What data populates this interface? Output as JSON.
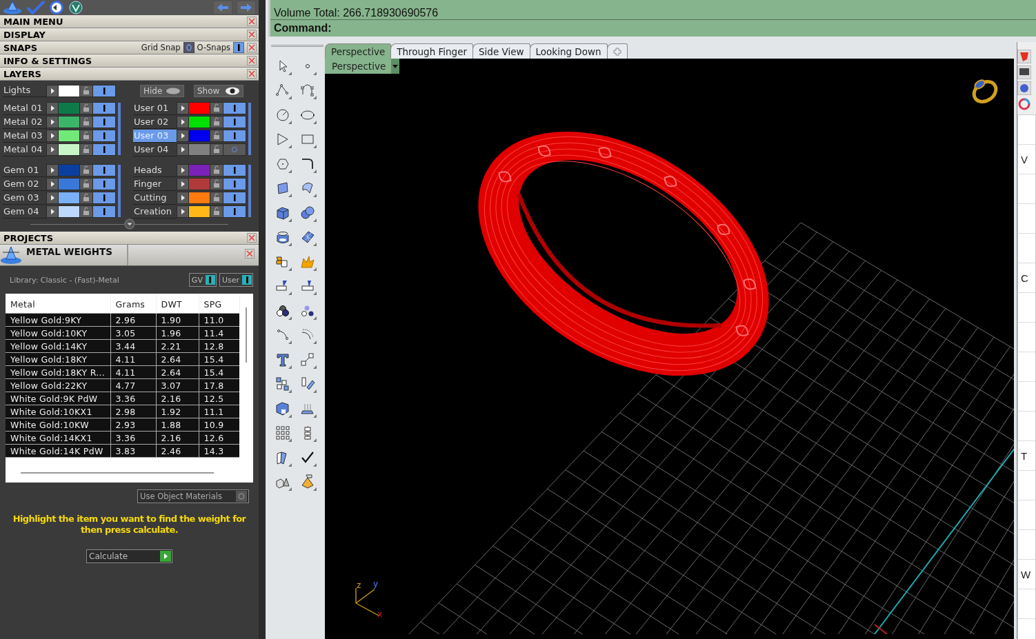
{
  "left_panel": {
    "panel_headers": [
      {
        "label": "MAIN MENU"
      },
      {
        "label": "DISPLAY"
      },
      {
        "label": "SNAPS",
        "toggles": [
          {
            "label": "Grid Snap",
            "on": false
          },
          {
            "label": "O-Snaps",
            "on": true
          }
        ]
      },
      {
        "label": "INFO & SETTINGS"
      },
      {
        "label": "LAYERS"
      }
    ],
    "layers": {
      "lights": {
        "label": "Lights",
        "color": "#ffffff",
        "visible": true
      },
      "hide_button": "Hide",
      "show_button": "Show",
      "groups": [
        {
          "left": [
            {
              "label": "Metal 01",
              "color": "#0e7a4a",
              "visible": true,
              "selected": false
            },
            {
              "label": "Metal 02",
              "color": "#3cb56a",
              "visible": true,
              "selected": false
            },
            {
              "label": "Metal 03",
              "color": "#72e87a",
              "visible": true,
              "selected": false
            },
            {
              "label": "Metal 04",
              "color": "#c8f5c8",
              "visible": true,
              "selected": false
            }
          ],
          "right": [
            {
              "label": "User 01",
              "color": "#ff0000",
              "visible": true,
              "selected": false
            },
            {
              "label": "User 02",
              "color": "#00e000",
              "visible": true,
              "selected": false
            },
            {
              "label": "User 03",
              "color": "#0000ee",
              "visible": true,
              "selected": true
            },
            {
              "label": "User 04",
              "color": "#808080",
              "visible": false,
              "selected": false
            }
          ]
        },
        {
          "left": [
            {
              "label": "Gem 01",
              "color": "#0a3fa0",
              "visible": true,
              "selected": false
            },
            {
              "label": "Gem 02",
              "color": "#3a78d8",
              "visible": true,
              "selected": false
            },
            {
              "label": "Gem 03",
              "color": "#7ab0f5",
              "visible": true,
              "selected": false
            },
            {
              "label": "Gem 04",
              "color": "#bcd8ff",
              "visible": true,
              "selected": false
            }
          ],
          "right": [
            {
              "label": "Heads",
              "color": "#7a22b8",
              "visible": true,
              "selected": false
            },
            {
              "label": "Finger",
              "color": "#b03a3a",
              "visible": true,
              "selected": false
            },
            {
              "label": "Cutting",
              "color": "#ff7a10",
              "visible": true,
              "selected": false
            },
            {
              "label": "Creation",
              "color": "#ffb818",
              "visible": true,
              "selected": false
            }
          ]
        }
      ]
    },
    "projects_header": "PROJECTS",
    "metal_weights": {
      "title": "METAL WEIGHTS",
      "library": "Library: Classic - (Fast)-Metal",
      "toggles": [
        {
          "label": "GV",
          "on": true
        },
        {
          "label": "User",
          "on": true
        }
      ],
      "table": {
        "columns": [
          "Metal",
          "Grams",
          "DWT",
          "SPG"
        ],
        "rows": [
          [
            "Yellow Gold:9KY",
            "2.96",
            "1.90",
            "11.0"
          ],
          [
            "Yellow Gold:10KY",
            "3.05",
            "1.96",
            "11.4"
          ],
          [
            "Yellow Gold:14KY",
            "3.44",
            "2.21",
            "12.8"
          ],
          [
            "Yellow Gold:18KY",
            "4.11",
            "2.64",
            "15.4"
          ],
          [
            "Yellow Gold:18KY R...",
            "4.11",
            "2.64",
            "15.4"
          ],
          [
            "Yellow Gold:22KY",
            "4.77",
            "3.07",
            "17.8"
          ],
          [
            "White Gold:9K PdW",
            "3.36",
            "2.16",
            "12.5"
          ],
          [
            "White Gold:10KX1",
            "2.98",
            "1.92",
            "11.1"
          ],
          [
            "White Gold:10KW",
            "2.93",
            "1.88",
            "10.9"
          ],
          [
            "White Gold:14KX1",
            "3.36",
            "2.16",
            "12.6"
          ],
          [
            "White Gold:14K PdW",
            "3.83",
            "2.46",
            "14.3"
          ]
        ]
      },
      "use_object_materials": {
        "label": "Use Object Materials",
        "checked": false
      },
      "hint": "Highlight the item you want to find the weight for then press calculate.",
      "calculate_button": "Calculate"
    }
  },
  "command_area": {
    "lines": [
      "Volume Total: 266.718930690576"
    ],
    "prompt": "Command:"
  },
  "viewport": {
    "tabs": [
      {
        "label": "Perspective",
        "selected": true
      },
      {
        "label": "Through Finger",
        "selected": false
      },
      {
        "label": "Side View",
        "selected": false
      },
      {
        "label": "Looking Down",
        "selected": false
      }
    ],
    "view_menu": "Perspective",
    "axis_labels": [
      "z",
      "y",
      "x"
    ]
  },
  "right_panel": {
    "labels": [
      "V",
      "C",
      "T",
      "W"
    ]
  }
}
